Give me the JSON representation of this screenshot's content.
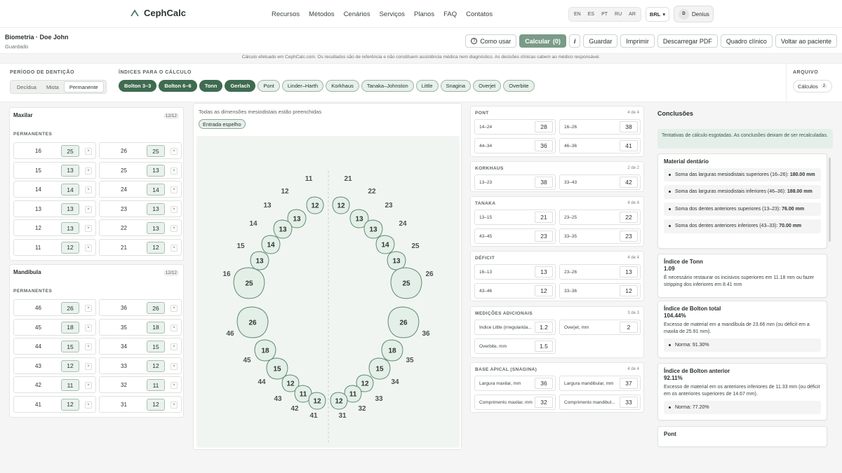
{
  "app": {
    "name": "CephCalc",
    "nav": [
      "Recursos",
      "Métodos",
      "Cenários",
      "Serviços",
      "Planos",
      "FAQ",
      "Contatos"
    ],
    "langs": [
      "EN",
      "ES",
      "PT",
      "RU",
      "AR"
    ],
    "currency": "BRL",
    "user_initial": "D",
    "user_name": "Denius"
  },
  "header": {
    "title": "Biometria · Doe John",
    "subtitle": "Guardado",
    "help": "Como usar",
    "calc": "Calcular",
    "calc_count": "(0)",
    "info": "i",
    "save": "Guardar",
    "print": "Imprimir",
    "pdf": "Descarregar PDF",
    "clinical": "Quadro clínico",
    "back": "Voltar ao paciente"
  },
  "disclaimer": "Cálculo efetuado em CephCalc.com. Os resultados são de referência e não constituem assistência médica nem diagnóstico. As decisões clínicas cabem ao médico responsável.",
  "options": {
    "period_label": "PERÍODO DE DENTIÇÃO",
    "periods": [
      "Decídua",
      "Mista",
      "Permanente"
    ],
    "active_period": "Permanente",
    "indices_label": "ÍNDICES PARA O CÁLCULO",
    "indices": [
      {
        "label": "Bolton 3–3",
        "on": true
      },
      {
        "label": "Bolton 6–6",
        "on": true
      },
      {
        "label": "Tonn",
        "on": true
      },
      {
        "label": "Gerlach",
        "on": true
      },
      {
        "label": "Pont",
        "on": false
      },
      {
        "label": "Linder–Harth",
        "on": false
      },
      {
        "label": "Korkhaus",
        "on": false
      },
      {
        "label": "Tanaka–Johnston",
        "on": false
      },
      {
        "label": "Little",
        "on": false
      },
      {
        "label": "Snagina",
        "on": false
      },
      {
        "label": "Overjet",
        "on": false
      },
      {
        "label": "Overbite",
        "on": false
      }
    ],
    "archive_label": "ARQUIVO",
    "archive_btn": "Cálculos",
    "archive_count": "2"
  },
  "maxilar": {
    "title": "Maxilar",
    "count": "12/12",
    "sub": "PERMANENTES",
    "rows": [
      [
        {
          "n": "16",
          "v": "25"
        },
        {
          "n": "26",
          "v": "25"
        }
      ],
      [
        {
          "n": "15",
          "v": "13"
        },
        {
          "n": "25",
          "v": "13"
        }
      ],
      [
        {
          "n": "14",
          "v": "14"
        },
        {
          "n": "24",
          "v": "14"
        }
      ],
      [
        {
          "n": "13",
          "v": "13"
        },
        {
          "n": "23",
          "v": "13"
        }
      ],
      [
        {
          "n": "12",
          "v": "13"
        },
        {
          "n": "22",
          "v": "13"
        }
      ],
      [
        {
          "n": "11",
          "v": "12"
        },
        {
          "n": "21",
          "v": "12"
        }
      ]
    ]
  },
  "mandibula": {
    "title": "Mandíbula",
    "count": "12/12",
    "sub": "PERMANENTES",
    "rows": [
      [
        {
          "n": "46",
          "v": "26"
        },
        {
          "n": "36",
          "v": "26"
        }
      ],
      [
        {
          "n": "45",
          "v": "18"
        },
        {
          "n": "35",
          "v": "18"
        }
      ],
      [
        {
          "n": "44",
          "v": "15"
        },
        {
          "n": "34",
          "v": "15"
        }
      ],
      [
        {
          "n": "43",
          "v": "12"
        },
        {
          "n": "33",
          "v": "12"
        }
      ],
      [
        {
          "n": "42",
          "v": "11"
        },
        {
          "n": "32",
          "v": "11"
        }
      ],
      [
        {
          "n": "41",
          "v": "12"
        },
        {
          "n": "31",
          "v": "12"
        }
      ]
    ]
  },
  "middle": {
    "hint": "Todas as dimensões mesiodistais estão preenchidas",
    "mirror": "Entrada espelho"
  },
  "chart_data": {
    "type": "diagram",
    "upper": [
      {
        "t": "11",
        "v": 12
      },
      {
        "t": "12",
        "v": 13
      },
      {
        "t": "13",
        "v": 13
      },
      {
        "t": "14",
        "v": 14
      },
      {
        "t": "15",
        "v": 13
      },
      {
        "t": "16",
        "v": 25
      },
      {
        "t": "21",
        "v": 12
      },
      {
        "t": "22",
        "v": 13
      },
      {
        "t": "23",
        "v": 13
      },
      {
        "t": "24",
        "v": 14
      },
      {
        "t": "25",
        "v": 13
      },
      {
        "t": "26",
        "v": 25
      }
    ],
    "lower": [
      {
        "t": "46",
        "v": 26
      },
      {
        "t": "45",
        "v": 18
      },
      {
        "t": "44",
        "v": 15
      },
      {
        "t": "43",
        "v": 12
      },
      {
        "t": "42",
        "v": 11
      },
      {
        "t": "41",
        "v": 12
      },
      {
        "t": "36",
        "v": 26
      },
      {
        "t": "35",
        "v": 18
      },
      {
        "t": "34",
        "v": 15
      },
      {
        "t": "33",
        "v": 12
      },
      {
        "t": "32",
        "v": 11
      },
      {
        "t": "31",
        "v": 12
      }
    ]
  },
  "sections": [
    {
      "key": "pont",
      "title": "PONT",
      "count": "4 de 4",
      "cells": [
        {
          "k": "14–24",
          "v": "28"
        },
        {
          "k": "16–26",
          "v": "38"
        },
        {
          "k": "44–34",
          "v": "36"
        },
        {
          "k": "46–36",
          "v": "41"
        }
      ]
    },
    {
      "key": "korkhaus",
      "title": "KORKHAUS",
      "count": "2 de 2",
      "cells": [
        {
          "k": "13–23",
          "v": "38"
        },
        {
          "k": "33–43",
          "v": "42"
        }
      ]
    },
    {
      "key": "tanaka",
      "title": "TANAKA",
      "count": "4 de 4",
      "cells": [
        {
          "k": "13–15",
          "v": "21"
        },
        {
          "k": "23–25",
          "v": "22"
        },
        {
          "k": "43–45",
          "v": "23"
        },
        {
          "k": "33–35",
          "v": "23"
        }
      ]
    },
    {
      "key": "deficit",
      "title": "DÉFICIT",
      "count": "4 de 4",
      "cells": [
        {
          "k": "16–13",
          "v": "13"
        },
        {
          "k": "23–26",
          "v": "13"
        },
        {
          "k": "43–46",
          "v": "12"
        },
        {
          "k": "33–36",
          "v": "12"
        }
      ]
    },
    {
      "key": "extra",
      "title": "MEDIÇÕES ADICIONAIS",
      "count": "3 de 3",
      "cells": [
        {
          "k": "Índice Little (irregularida...",
          "v": "1.2"
        },
        {
          "k": "Overjet, mm",
          "v": "2"
        },
        {
          "k": "Overbite, mm",
          "v": "1.5"
        }
      ]
    },
    {
      "key": "base",
      "title": "BASE APICAL (SNAGINA)",
      "count": "4 de 4",
      "cells": [
        {
          "k": "Largura maxilar, mm",
          "v": "36"
        },
        {
          "k": "Largura mandibular, mm",
          "v": "37"
        },
        {
          "k": "Comprimento maxilar, mm",
          "v": "32"
        },
        {
          "k": "Comprimento mandibul...",
          "v": "33"
        }
      ]
    }
  ],
  "conclusions": {
    "title": "Conclusões",
    "alert": "Tentativas de cálculo esgotadas. As conclusões deixam de ser recalculadas.",
    "material": {
      "title": "Material dentário",
      "items": [
        {
          "t": "Soma das larguras mesiodistais superiores (16–26): ",
          "b": "180.00 mm"
        },
        {
          "t": "Soma das larguras mesiodistais inferiores (46–36): ",
          "b": "188.00 mm"
        },
        {
          "t": "Soma dos dentes anteriores superiores (13–23): ",
          "b": "76.00 mm"
        },
        {
          "t": "Soma dos dentes anteriores inferiores (43–33): ",
          "b": "70.00 mm"
        }
      ]
    },
    "tonn": {
      "title": "Índice de Tonn",
      "value": "1.09",
      "text": "É necessário restaurar os incisivos superiores em 11.18 mm ou fazer stripping dos inferiores em 8.41 mm"
    },
    "bolton_total": {
      "title": "Índice de Bolton total",
      "value": "104.44%",
      "text": "Excesso de material em a mandíbula de 23.66 mm (ou déficit em a maxila de 25.91 mm).",
      "norm": "Norma: 91.30%"
    },
    "bolton_ant": {
      "title": "Índice de Bolton anterior",
      "value": "92.11%",
      "text": "Excesso de material em os anteriores inferiores de 11.33 mm (ou déficit em os anteriores superiores de 14.67 mm).",
      "norm": "Norma: 77.20%"
    },
    "pont": {
      "title": "Pont"
    }
  }
}
